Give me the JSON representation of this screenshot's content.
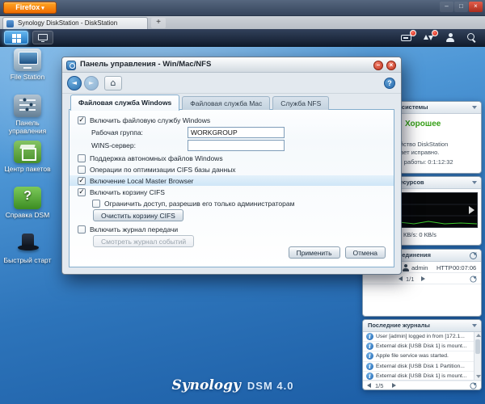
{
  "browser": {
    "menu_button": "Firefox",
    "menu_caret": "▾",
    "tab_title": "Synology DiskStation - DiskStation",
    "new_tab": "+",
    "minimize": "–",
    "maximize": "□",
    "close": "×"
  },
  "desktop": {
    "icons": [
      {
        "label": "File Station"
      },
      {
        "label": "Панель управления"
      },
      {
        "label": "Центр пакетов"
      },
      {
        "label": "Справка DSM"
      },
      {
        "label": "Быстрый старт"
      }
    ],
    "branding_script": "Synology",
    "branding_product": "DSM 4.0"
  },
  "control_panel": {
    "title": "Панель управления - Win/Mac/NFS",
    "minimize_glyph": "–",
    "close_glyph": "×",
    "toolbar": {
      "back": "◄",
      "forward": "►",
      "home": "⌂",
      "help": "?"
    },
    "tabs": [
      {
        "label": "Файловая служба Windows"
      },
      {
        "label": "Файловая служба Mac"
      },
      {
        "label": "Служба NFS"
      }
    ],
    "form": {
      "enable_smb_label": "Включить файловую службу Windows",
      "enable_smb_mark": "✓",
      "workgroup_label": "Рабочая группа:",
      "workgroup_value": "WORKGROUP",
      "wins_label": "WINS-сервер:",
      "wins_value": "",
      "offline_label": "Поддержка автономных файлов Windows",
      "offline_mark": "",
      "cifsdb_label": "Операции по оптимизации CIFS базы данных",
      "cifsdb_mark": "",
      "lmb_label": "Включение Local Master Browser",
      "lmb_mark": "✓",
      "recycle_label": "Включить корзину CIFS",
      "recycle_mark": "✓",
      "restrict_label": "Ограничить доступ, разрешив его только администраторам",
      "restrict_mark": "",
      "clear_recycle_button": "Очистить корзину CIFS",
      "translog_label": "Включить журнал передачи",
      "translog_mark": "",
      "viewlog_button": "Смотреть журнал событий"
    },
    "apply_button": "Применить",
    "cancel_button": "Отмена"
  },
  "widgets": {
    "system_health": {
      "header": "Состояние системы",
      "status": "Хорошее",
      "description": "Устройство DiskStation работает исправно.",
      "uptime": "Время работы: 0:1:12:32"
    },
    "resources": {
      "header": "Монитор ресурсов",
      "legend": "КВ/s: 0 КВ/s"
    },
    "connections": {
      "header": "Текущие соединения",
      "row": {
        "user": "admin",
        "protocol": "HTTP",
        "time": "00:07:06"
      },
      "page": "1/1"
    },
    "logs": {
      "header": "Последние журналы",
      "entries": [
        "User [admin] logged in from [172.1...",
        "External disk [USB Disk 1] is mount...",
        "Apple file service was started.",
        "External disk [USB Disk 1 Partition...",
        "External disk [USB Disk 1] is mount..."
      ],
      "page": "1/5"
    }
  }
}
